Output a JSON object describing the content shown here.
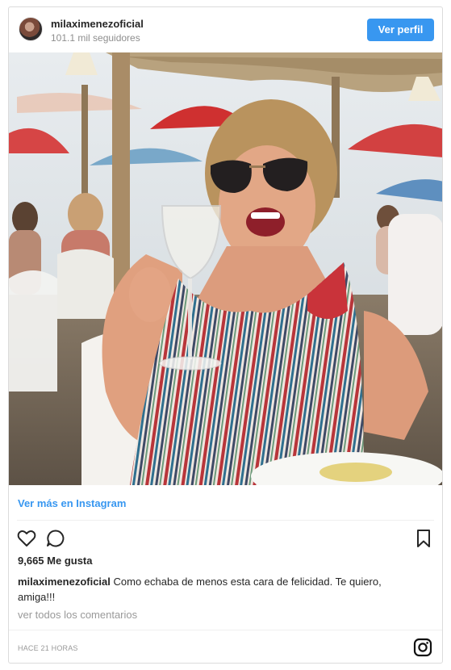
{
  "header": {
    "username": "milaximenezoficial",
    "followers": "101.1 mil seguidores",
    "view_profile_label": "Ver perfil"
  },
  "post": {
    "image_icon": "post-photo",
    "view_more_label": "Ver más en Instagram",
    "likes": "9,665 Me gusta",
    "caption_user": "milaximenezoficial",
    "caption_text": "Como echaba de menos esta cara de felicidad. Te quiero, amiga!!!",
    "comments_label": "ver todos los comentarios",
    "timestamp": "HACE 21 HORAS"
  },
  "icons": {
    "like": "heart-icon",
    "comment": "comment-icon",
    "save": "bookmark-icon",
    "brand": "instagram-icon"
  },
  "colors": {
    "accent": "#3897f0",
    "text": "#262626",
    "muted": "#999999"
  }
}
